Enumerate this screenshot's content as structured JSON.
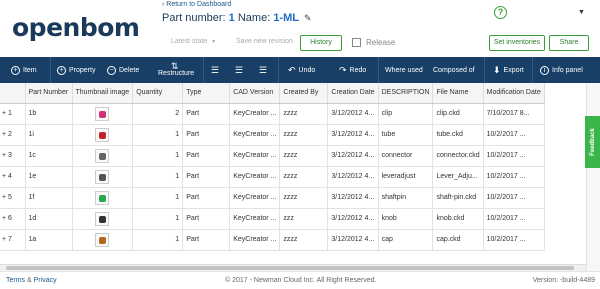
{
  "header": {
    "logo": "openbom",
    "back_link": "‹ Return to Dashboard",
    "part_number_label": "Part number:",
    "part_number": "1",
    "name_label": "Name:",
    "name": "1-ML",
    "latest_state": "Latest state",
    "save_revision": "Save new revision",
    "history": "History",
    "release": "Release",
    "set_inventories": "Set inventories",
    "share": "Share"
  },
  "toolbar": {
    "item": "Item",
    "property": "Property",
    "delete": "Delete",
    "restructure": "Restructure",
    "undo": "Undo",
    "redo": "Redo",
    "where_used": "Where used",
    "composed_of": "Composed of",
    "export": "Export",
    "info_panel": "Info panel"
  },
  "grid": {
    "columns": [
      "",
      "Part Number",
      "Thumbnail image",
      "Quantity",
      "Type",
      "CAD Version",
      "Created By",
      "Creation Date",
      "DESCRIPTION",
      "File Name",
      "Modification Date"
    ],
    "rows": [
      {
        "idx": "1",
        "part": "1b",
        "qty": "2",
        "type": "Part",
        "cad": "KeyCreator ...",
        "by": "zzzz",
        "created": "3/12/2012 4...",
        "desc": "clip",
        "file": "clip.ckd",
        "modified": "7/10/2017 8..."
      },
      {
        "idx": "2",
        "part": "1i",
        "qty": "1",
        "type": "Part",
        "cad": "KeyCreator ...",
        "by": "zzzz",
        "created": "3/12/2012 4...",
        "desc": "tube",
        "file": "tube.ckd",
        "modified": "10/2/2017 ..."
      },
      {
        "idx": "3",
        "part": "1c",
        "qty": "1",
        "type": "Part",
        "cad": "KeyCreator ...",
        "by": "zzzz",
        "created": "3/12/2012 4...",
        "desc": "connector",
        "file": "connector.ckd",
        "modified": "10/2/2017 ..."
      },
      {
        "idx": "4",
        "part": "1e",
        "qty": "1",
        "type": "Part",
        "cad": "KeyCreator ...",
        "by": "zzzz",
        "created": "3/12/2012 4...",
        "desc": "leveradjust",
        "file": "Lever_Adju...",
        "modified": "10/2/2017 ..."
      },
      {
        "idx": "5",
        "part": "1f",
        "qty": "1",
        "type": "Part",
        "cad": "KeyCreator ...",
        "by": "zzzz",
        "created": "3/12/2012 4...",
        "desc": "shaftpin",
        "file": "shaft-pin.ckd",
        "modified": "10/2/2017 ..."
      },
      {
        "idx": "6",
        "part": "1d",
        "qty": "1",
        "type": "Part",
        "cad": "KeyCreator ...",
        "by": "zzz",
        "created": "3/12/2012 4...",
        "desc": "knob",
        "file": "knob.ckd",
        "modified": "10/2/2017 ..."
      },
      {
        "idx": "7",
        "part": "1a",
        "qty": "1",
        "type": "Part",
        "cad": "KeyCreator ...",
        "by": "zzzz",
        "created": "3/12/2012 4...",
        "desc": "cap",
        "file": "cap.ckd",
        "modified": "10/2/2017 ..."
      }
    ]
  },
  "feedback": "Feedback",
  "footer": {
    "terms": "Terms",
    "amp": "&",
    "privacy": "Privacy",
    "copyright": "© 2017 - Newman Cloud Inc. All Right Reserved.",
    "version": "Version: -build-4489"
  },
  "colors": {
    "toolbar_bg": "#183f66",
    "accent_green": "#3a9d3a",
    "link_blue": "#1a6fc4"
  }
}
